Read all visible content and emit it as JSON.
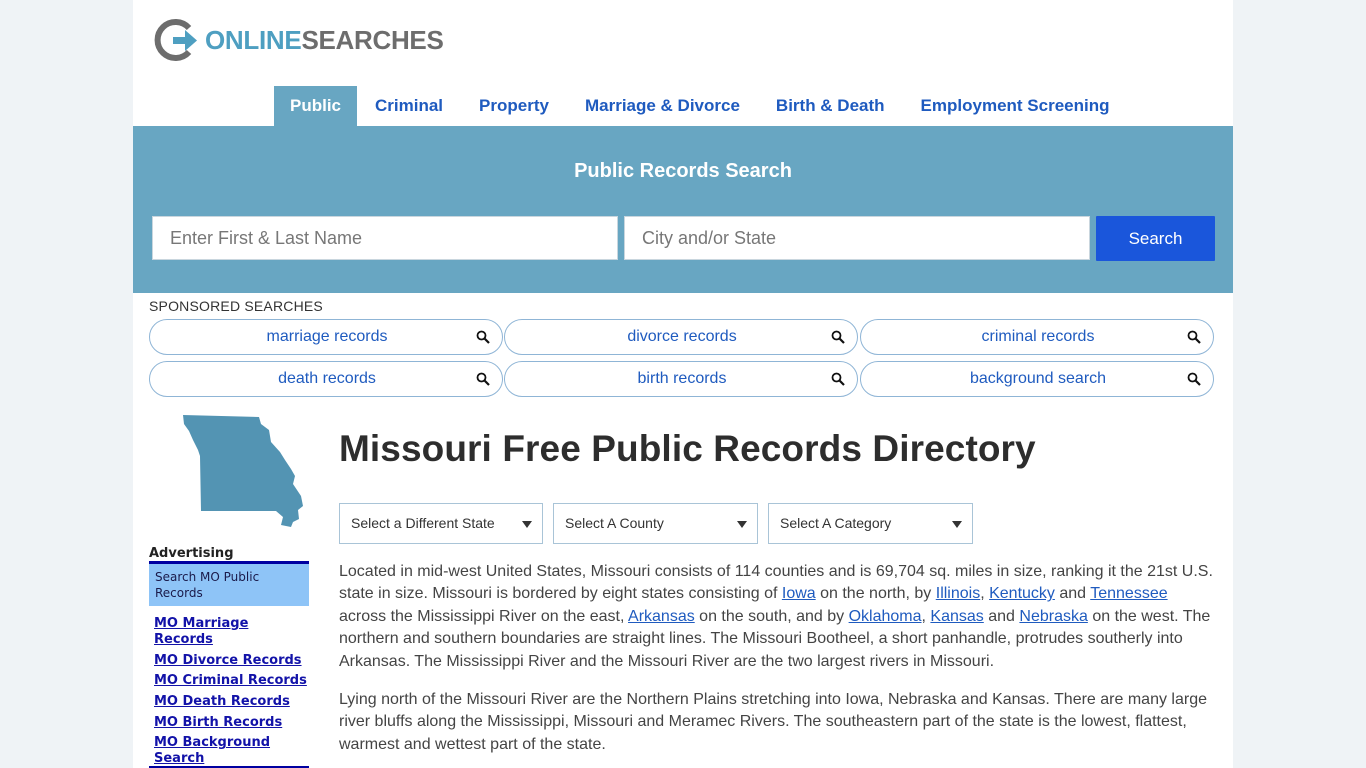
{
  "logo": {
    "part1": "ONLINE",
    "part2": "SEARCHES"
  },
  "nav": [
    {
      "label": "Public",
      "active": true
    },
    {
      "label": "Criminal"
    },
    {
      "label": "Property"
    },
    {
      "label": "Marriage & Divorce"
    },
    {
      "label": "Birth & Death"
    },
    {
      "label": "Employment Screening"
    }
  ],
  "search": {
    "title": "Public Records Search",
    "name_placeholder": "Enter First & Last Name",
    "city_placeholder": "City and/or State",
    "button_label": "Search"
  },
  "sponsored": {
    "label": "SPONSORED SEARCHES",
    "items": [
      "marriage records",
      "divorce records",
      "criminal records",
      "death records",
      "birth records",
      "background search"
    ]
  },
  "sidebar": {
    "advertising_label": "Advertising",
    "box_text": "Search MO Public Records",
    "links": [
      "MO Marriage Records",
      "MO Divorce Records",
      "MO Criminal Records",
      "MO Death Records",
      "MO Birth Records",
      "MO Background Search"
    ]
  },
  "main": {
    "title": "Missouri Free Public Records Directory",
    "selects": [
      "Select a Different State",
      "Select A County",
      "Select A Category"
    ],
    "p1": {
      "t1": "Located in mid-west United States, Missouri consists of 114 counties and is 69,704 sq. miles in size, ranking it the 21st U.S. state in size. Missouri is bordered by eight states consisting of ",
      "l_iowa": "Iowa",
      "t2": " on the north, by ",
      "l_illinois": "Illinois",
      "t3": ", ",
      "l_kentucky": "Kentucky",
      "t4": " and ",
      "l_tennessee": "Tennessee",
      "t5": " across the Mississippi River on the east, ",
      "l_arkansas": "Arkansas",
      "t6": " on the south, and by ",
      "l_oklahoma": "Oklahoma",
      "t7": ", ",
      "l_kansas": "Kansas",
      "t8": " and ",
      "l_nebraska": "Nebraska",
      "t9": " on the west. The northern and southern boundaries are straight lines. The Missouri Bootheel, a short panhandle, protrudes southerly into Arkansas. The Mississippi River and the Missouri River are the two largest rivers in Missouri."
    },
    "p2": "Lying north of the Missouri River are the Northern Plains stretching into Iowa, Nebraska and Kansas. There are many large river bluffs along the Mississippi, Missouri and Meramec Rivers. The southeastern part of the state is the lowest, flattest, warmest and wettest part of the state."
  },
  "colors": {
    "accent": "#68a6c2",
    "button": "#1a56db",
    "link": "#1f5bbf"
  }
}
